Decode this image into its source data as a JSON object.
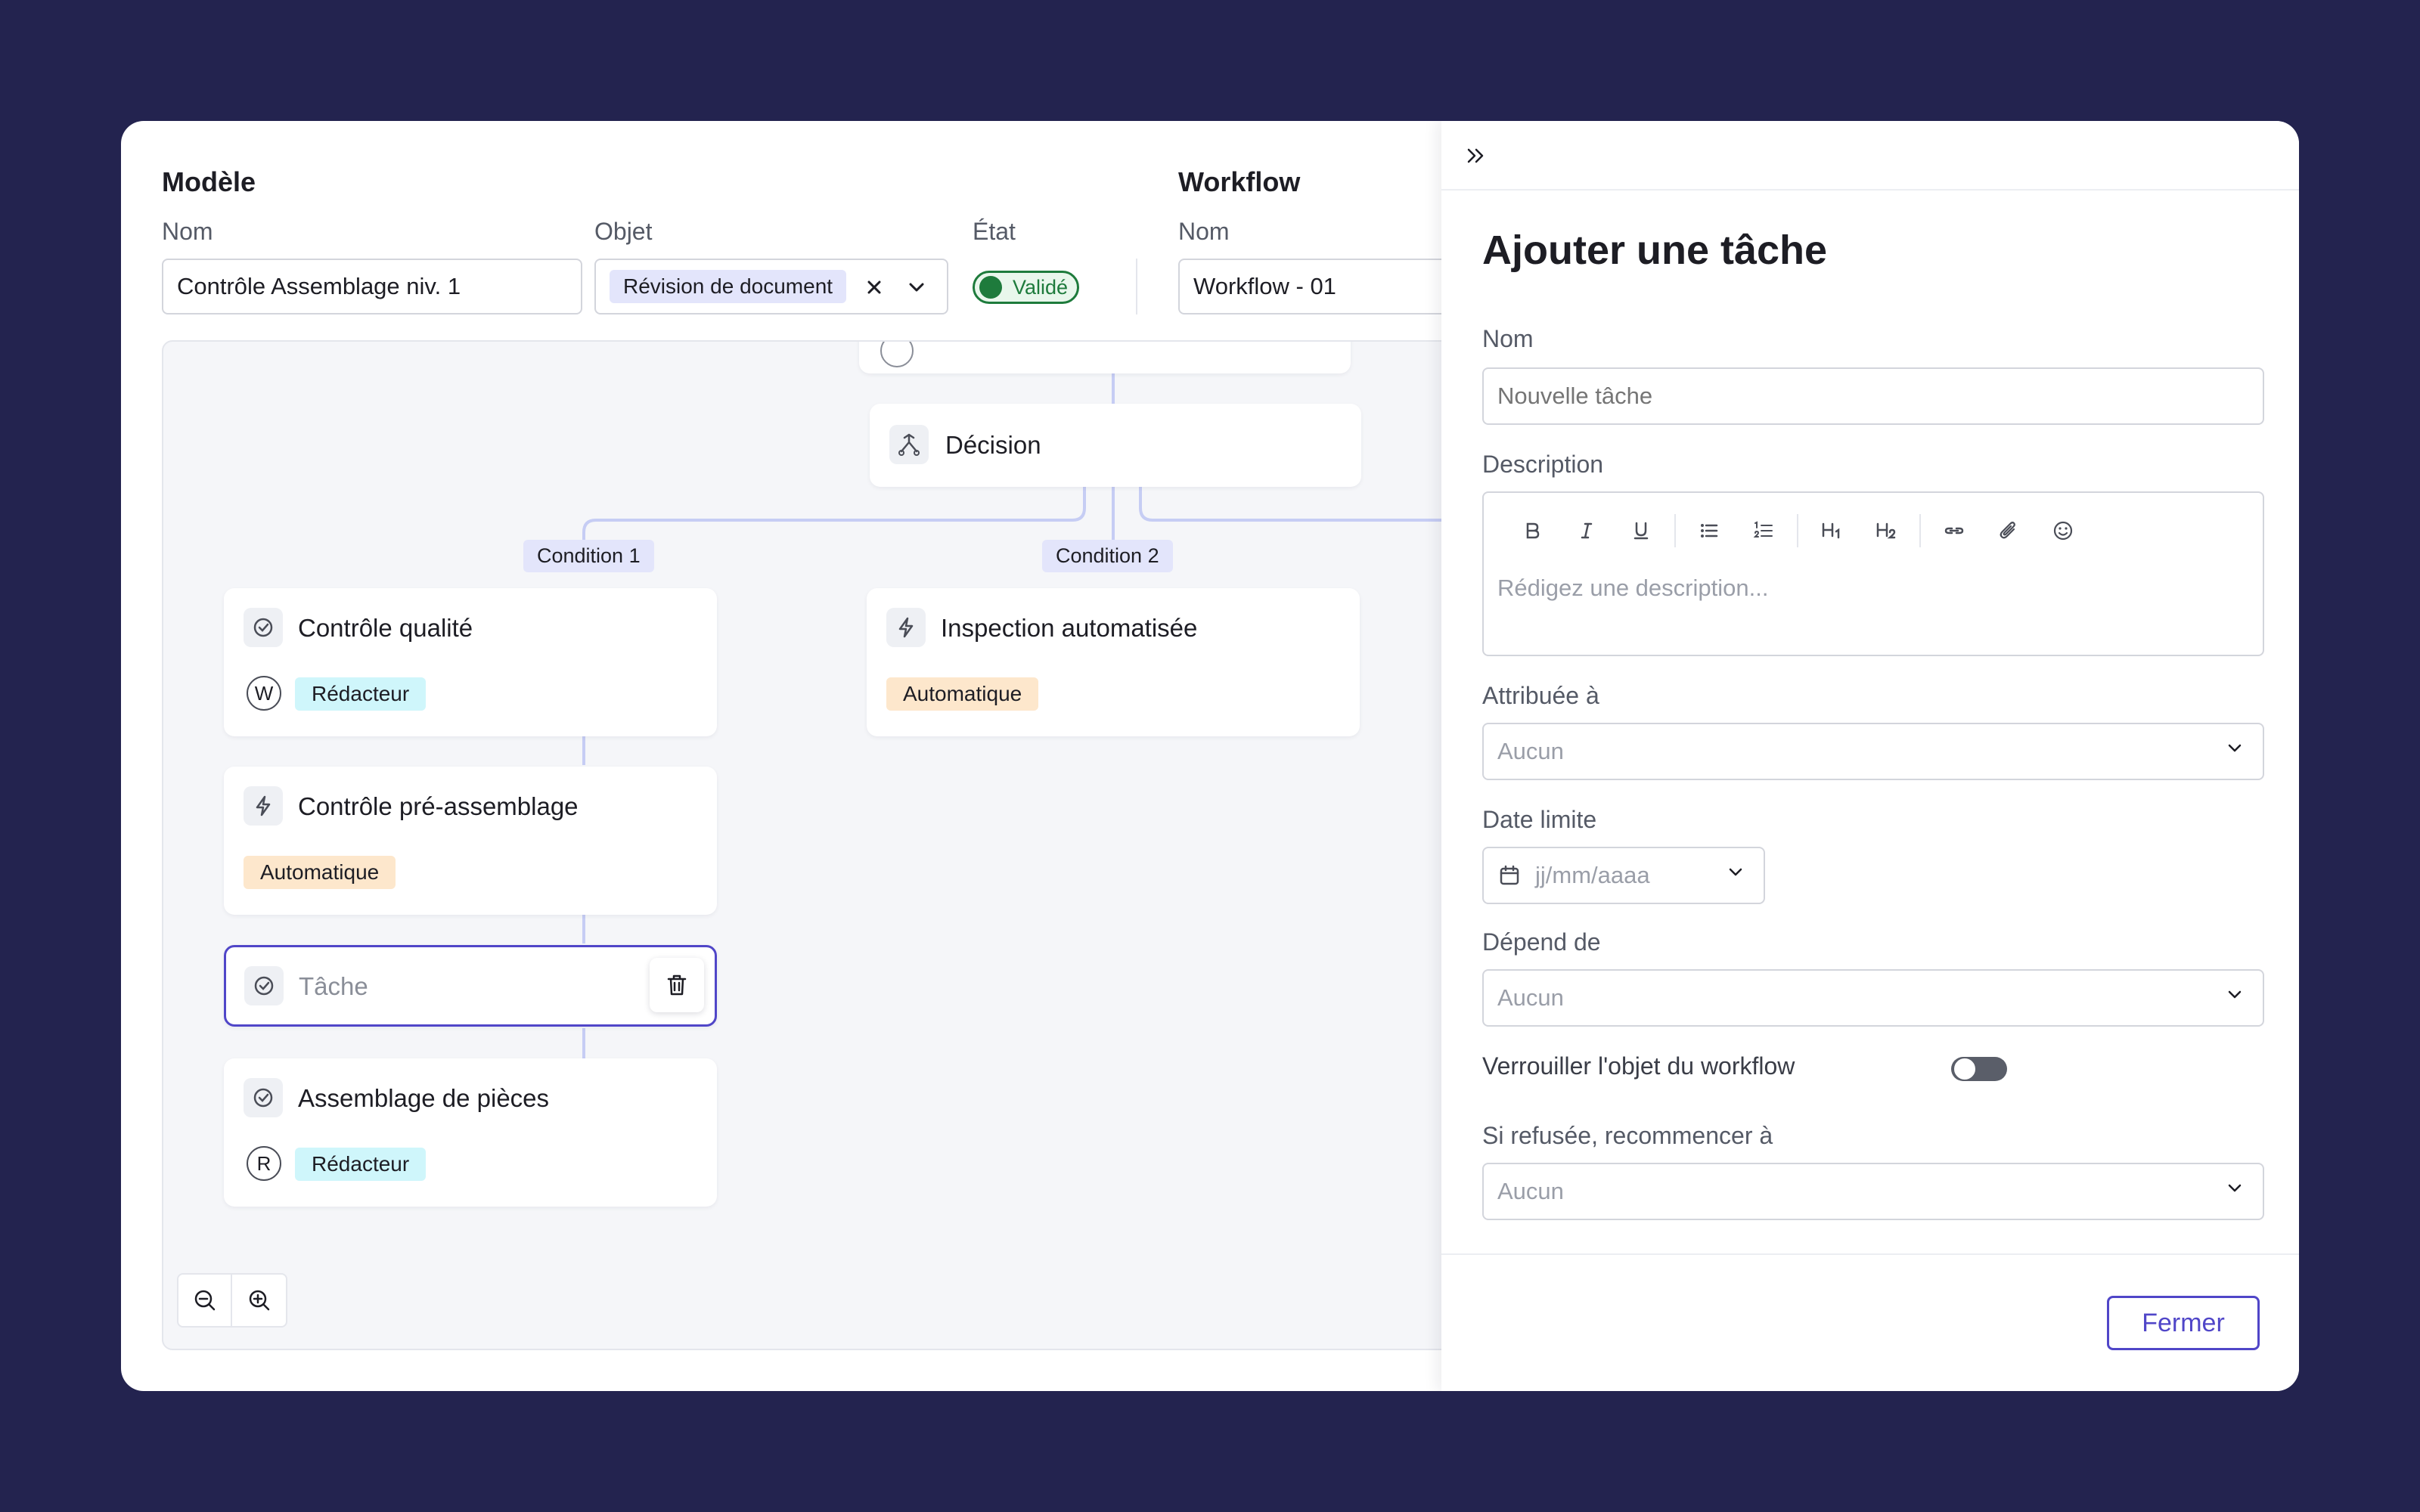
{
  "modele": {
    "title": "Modèle",
    "nom_label": "Nom",
    "nom_value": "Contrôle Assemblage niv. 1",
    "objet_label": "Objet",
    "objet_chip": "Révision de document",
    "etat_label": "État",
    "etat_value": "Validé"
  },
  "workflow": {
    "title": "Workflow",
    "nom_label": "Nom",
    "nom_value": "Workflow - 01"
  },
  "canvas": {
    "decision": "Décision",
    "condition1": "Condition 1",
    "condition2": "Condition 2",
    "cards": [
      {
        "title": "Contrôle qualité",
        "avatar": "W",
        "tag": "Rédacteur"
      },
      {
        "title": "Contrôle pré-assemblage",
        "tag": "Automatique"
      },
      {
        "title": "Tâche"
      },
      {
        "title": "Assemblage de pièces",
        "avatar": "R",
        "tag": "Rédacteur"
      },
      {
        "title": "Inspection automatisée",
        "tag": "Automatique"
      }
    ]
  },
  "panel": {
    "heading": "Ajouter une tâche",
    "nom_label": "Nom",
    "nom_placeholder": "Nouvelle tâche",
    "description_label": "Description",
    "description_placeholder": "Rédigez une description...",
    "attribuee_label": "Attribuée à",
    "attribuee_value": "Aucun",
    "date_label": "Date limite",
    "date_placeholder": "jj/mm/aaaa",
    "depend_label": "Dépend de",
    "depend_value": "Aucun",
    "verrouiller_label": "Verrouiller l'objet du workflow",
    "verrouiller_on": false,
    "refusee_label": "Si refusée, recommencer à",
    "refusee_value": "Aucun",
    "close_label": "Fermer"
  },
  "colors": {
    "background": "#23234f",
    "accent": "#5046c8",
    "status_green": "#1e7b3c"
  }
}
